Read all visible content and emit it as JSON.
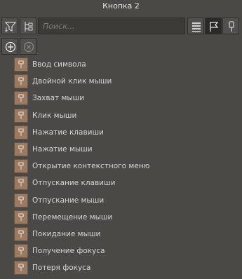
{
  "window": {
    "title": "Кнопка 2"
  },
  "toolbar": {
    "search_placeholder": "Поиск..."
  },
  "events": [
    {
      "label": "Ввод символа"
    },
    {
      "label": "Двойной клик мыши"
    },
    {
      "label": "Захват мыши"
    },
    {
      "label": "Клик мыши"
    },
    {
      "label": "Нажатие клавиши"
    },
    {
      "label": "Нажатие мыши"
    },
    {
      "label": "Открытие контекстного меню"
    },
    {
      "label": "Отпускание клавиши"
    },
    {
      "label": "Отпускание мыши"
    },
    {
      "label": "Перемещение мыши"
    },
    {
      "label": "Покидание мыши"
    },
    {
      "label": "Получение фокуса"
    },
    {
      "label": "Потеря фокуса"
    }
  ],
  "colors": {
    "background": "#4a4946",
    "event_icon": "#9a7b61",
    "text": "#d6d6d6"
  },
  "icons": {
    "toolbar_left": [
      "sort-filter-icon",
      "tree-filter-icon"
    ],
    "toolbar_right": [
      "list-view-icon",
      "flag-icon",
      "pin-icon"
    ],
    "row2": [
      "add-icon",
      "remove-icon"
    ],
    "event": "event-plug-icon"
  }
}
